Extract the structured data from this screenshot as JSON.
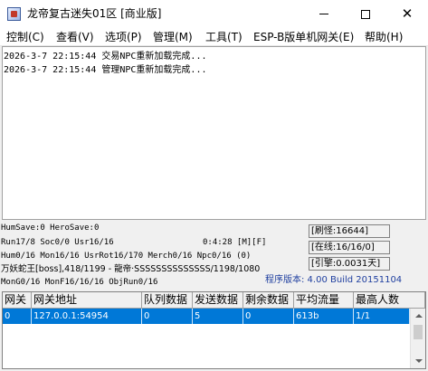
{
  "window": {
    "title": "龙帝复古迷失01区 [商业版]",
    "close_glyph": "✕"
  },
  "menu": {
    "items": [
      "控制(C)",
      "查看(V)",
      "选项(P)",
      "管理(M)",
      "工具(T)",
      "ESP-B版单机网关(E)",
      "帮助(H)"
    ]
  },
  "log": {
    "lines": [
      "2026-3-7 22:15:44 交易NPC重新加载完成...",
      "2026-3-7 22:15:44 管理NPC重新加载完成..."
    ]
  },
  "status": {
    "line1": "HumSave:0 HeroSave:0",
    "line2": "Run17/8 Soc0/0 Usr16/16",
    "time": "0:4:28 [M][F]",
    "line3": "Hum0/16 Mon16/16 UsrRot16/170 Merch0/16 Npc0/16 (0)",
    "line4": "万妖蛇王[boss],418/1199 - 龍帝·SSSSSSSSSSSSSS/1198/1080",
    "line5": "MonG0/16 MonF16/16/16 ObjRun0/16",
    "refresh": "[刷怪:16644]",
    "online": "[在线:16/16/0]",
    "engine": "[引擎:0.0031天]",
    "version": "程序版本: 4.00 Build 20151104"
  },
  "gateway_table": {
    "columns": [
      "网关",
      "网关地址",
      "队列数据",
      "发送数据",
      "剩余数据",
      "平均流量",
      "最高人数"
    ],
    "rows": [
      [
        "0",
        "127.0.0.1:54954",
        "0",
        "5",
        "0",
        "613b",
        "1/1"
      ]
    ]
  }
}
